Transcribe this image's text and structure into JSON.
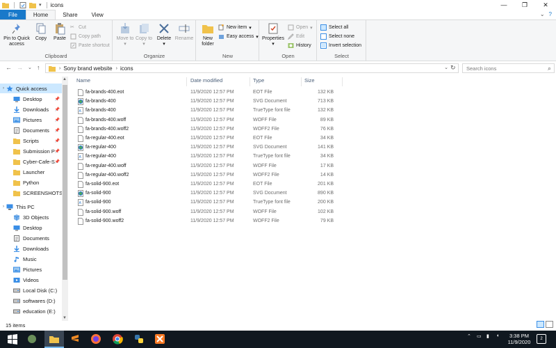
{
  "window": {
    "title": "icons",
    "controls": [
      "—",
      "❐",
      "✕"
    ]
  },
  "ribbon_tabs": {
    "file": "File",
    "home": "Home",
    "share": "Share",
    "view": "View"
  },
  "ribbon": {
    "clipboard": {
      "label": "Clipboard",
      "pin": "Pin to Quick access",
      "copy": "Copy",
      "paste": "Paste",
      "cut": "Cut",
      "copy_path": "Copy path",
      "paste_shortcut": "Paste shortcut"
    },
    "organize": {
      "label": "Organize",
      "move_to": "Move to",
      "copy_to": "Copy to",
      "delete": "Delete",
      "rename": "Rename"
    },
    "new": {
      "label": "New",
      "new_folder": "New folder",
      "new_item": "New item",
      "easy_access": "Easy access"
    },
    "open": {
      "label": "Open",
      "properties": "Properties",
      "open": "Open",
      "edit": "Edit",
      "history": "History"
    },
    "select": {
      "label": "Select",
      "select_all": "Select all",
      "select_none": "Select none",
      "invert": "Invert selection"
    }
  },
  "address": {
    "crumbs": [
      "Sony brand website",
      "icons"
    ],
    "search_placeholder": "Search icons"
  },
  "nav": {
    "quick_access": "Quick access",
    "items": [
      {
        "label": "Desktop",
        "icon": "desktop-icon",
        "pinned": true
      },
      {
        "label": "Downloads",
        "icon": "download-icon",
        "pinned": true
      },
      {
        "label": "Pictures",
        "icon": "pictures-icon",
        "pinned": true
      },
      {
        "label": "Documents",
        "icon": "documents-icon",
        "pinned": true
      },
      {
        "label": "Scripts",
        "icon": "folder-icon",
        "pinned": true
      },
      {
        "label": "Submission P",
        "icon": "folder-icon",
        "pinned": true
      },
      {
        "label": "Cyber-Cafe-S",
        "icon": "folder-icon",
        "pinned": true
      },
      {
        "label": "Launcher",
        "icon": "folder-icon",
        "pinned": false
      },
      {
        "label": "Python",
        "icon": "folder-icon",
        "pinned": false
      },
      {
        "label": "SCREENSHOTS",
        "icon": "folder-icon",
        "pinned": false
      }
    ],
    "this_pc": "This PC",
    "pc_items": [
      {
        "label": "3D Objects",
        "icon": "3d-objects-icon"
      },
      {
        "label": "Desktop",
        "icon": "desktop-icon"
      },
      {
        "label": "Documents",
        "icon": "documents-icon"
      },
      {
        "label": "Downloads",
        "icon": "download-icon"
      },
      {
        "label": "Music",
        "icon": "music-icon"
      },
      {
        "label": "Pictures",
        "icon": "pictures-icon"
      },
      {
        "label": "Videos",
        "icon": "videos-icon"
      },
      {
        "label": "Local Disk (C:)",
        "icon": "drive-icon"
      },
      {
        "label": "softwares (D:)",
        "icon": "drive-icon"
      },
      {
        "label": "education (E:)",
        "icon": "drive-icon"
      }
    ]
  },
  "columns": {
    "name": "Name",
    "date": "Date modified",
    "type": "Type",
    "size": "Size"
  },
  "files": [
    {
      "name": "fa-brands-400.eot",
      "date": "11/9/2020 12:57 PM",
      "type": "EOT File",
      "size": "132 KB",
      "icon": "file-icon"
    },
    {
      "name": "fa-brands-400",
      "date": "11/9/2020 12:57 PM",
      "type": "SVG Document",
      "size": "713 KB",
      "icon": "svg-icon"
    },
    {
      "name": "fa-brands-400",
      "date": "11/9/2020 12:57 PM",
      "type": "TrueType font file",
      "size": "132 KB",
      "icon": "font-icon"
    },
    {
      "name": "fa-brands-400.woff",
      "date": "11/9/2020 12:57 PM",
      "type": "WOFF File",
      "size": "89 KB",
      "icon": "file-icon"
    },
    {
      "name": "fa-brands-400.woff2",
      "date": "11/9/2020 12:57 PM",
      "type": "WOFF2 File",
      "size": "76 KB",
      "icon": "file-icon"
    },
    {
      "name": "fa-regular-400.eot",
      "date": "11/9/2020 12:57 PM",
      "type": "EOT File",
      "size": "34 KB",
      "icon": "file-icon"
    },
    {
      "name": "fa-regular-400",
      "date": "11/9/2020 12:57 PM",
      "type": "SVG Document",
      "size": "141 KB",
      "icon": "svg-icon"
    },
    {
      "name": "fa-regular-400",
      "date": "11/9/2020 12:57 PM",
      "type": "TrueType font file",
      "size": "34 KB",
      "icon": "font-icon"
    },
    {
      "name": "fa-regular-400.woff",
      "date": "11/9/2020 12:57 PM",
      "type": "WOFF File",
      "size": "17 KB",
      "icon": "file-icon"
    },
    {
      "name": "fa-regular-400.woff2",
      "date": "11/9/2020 12:57 PM",
      "type": "WOFF2 File",
      "size": "14 KB",
      "icon": "file-icon"
    },
    {
      "name": "fa-solid-900.eot",
      "date": "11/9/2020 12:57 PM",
      "type": "EOT File",
      "size": "201 KB",
      "icon": "file-icon"
    },
    {
      "name": "fa-solid-900",
      "date": "11/9/2020 12:57 PM",
      "type": "SVG Document",
      "size": "890 KB",
      "icon": "svg-icon"
    },
    {
      "name": "fa-solid-900",
      "date": "11/9/2020 12:57 PM",
      "type": "TrueType font file",
      "size": "200 KB",
      "icon": "font-icon"
    },
    {
      "name": "fa-solid-900.woff",
      "date": "11/9/2020 12:57 PM",
      "type": "WOFF File",
      "size": "102 KB",
      "icon": "file-icon"
    },
    {
      "name": "fa-solid-900.woff2",
      "date": "11/9/2020 12:57 PM",
      "type": "WOFF2 File",
      "size": "79 KB",
      "icon": "file-icon"
    }
  ],
  "status": {
    "item_count": "15 items"
  },
  "taskbar": {
    "time": "3:38 PM",
    "date": "11/9/2020",
    "notification_count": "2"
  },
  "colors": {
    "accent": "#1979ca",
    "selection": "#cce8ff",
    "folder": "#f0c24b",
    "taskbar": "#101820"
  }
}
